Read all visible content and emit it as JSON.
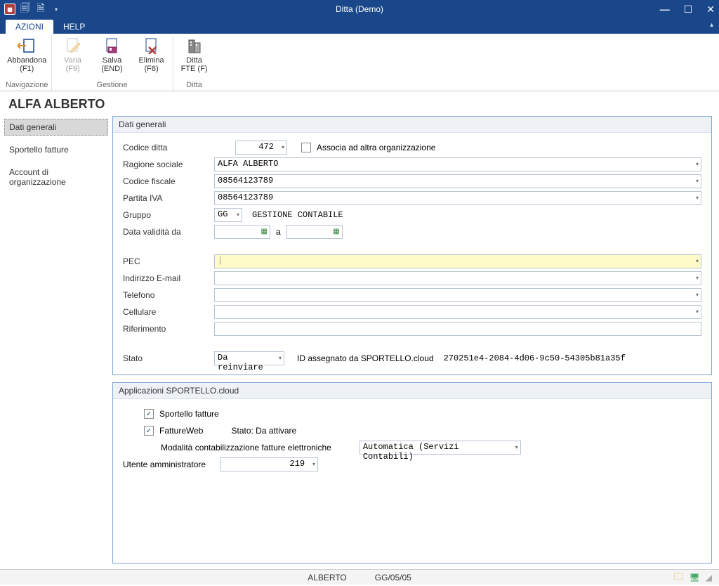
{
  "window": {
    "title": "Ditta  (Demo)"
  },
  "tabs": {
    "azioni": "AZIONI",
    "help": "HELP"
  },
  "ribbon": {
    "groups": {
      "navigazione": {
        "label": "Navigazione",
        "abbandona": {
          "label": "Abbandona",
          "sub": "(F1)"
        }
      },
      "gestione": {
        "label": "Gestione",
        "varia": {
          "label": "Varia",
          "sub": "(F9)"
        },
        "salva": {
          "label": "Salva",
          "sub": "(END)"
        },
        "elimina": {
          "label": "Elimina",
          "sub": "(F8)"
        }
      },
      "ditta": {
        "label": "Ditta",
        "dittafte": {
          "label": "Ditta",
          "sub": "FTE (F)"
        }
      }
    }
  },
  "heading": "ALFA ALBERTO",
  "sidebar": {
    "items": [
      {
        "label": "Dati generali"
      },
      {
        "label": "Sportello fatture"
      },
      {
        "label": "Account di organizzazione"
      }
    ]
  },
  "panel1": {
    "title": "Dati generali",
    "labels": {
      "codice_ditta": "Codice ditta",
      "associa": "Associa ad altra organizzazione",
      "ragione": "Ragione sociale",
      "cf": "Codice fiscale",
      "piva": "Partita IVA",
      "gruppo": "Gruppo",
      "gruppo_desc": "GESTIONE CONTABILE",
      "validita": "Data validità da",
      "a": "a",
      "pec": "PEC",
      "email": "Indirizzo E-mail",
      "tel": "Telefono",
      "cell": "Cellulare",
      "rif": "Riferimento",
      "stato": "Stato",
      "id_label": "ID assegnato da SPORTELLO.cloud"
    },
    "values": {
      "codice_ditta": "472",
      "ragione": "ALFA ALBERTO",
      "cf": "08564123789",
      "piva": "08564123789",
      "gruppo_code": "GG",
      "validita_da": "",
      "validita_a": "",
      "pec": "",
      "email": "",
      "tel": "",
      "cell": "",
      "rif": "",
      "stato": "Da reinviare",
      "id": "270251e4-2084-4d06-9c50-54305b81a35f"
    }
  },
  "panel2": {
    "title": "Applicazioni SPORTELLO.cloud",
    "sportello_fatture": "Sportello fatture",
    "fattureweb": "FattureWeb",
    "fw_stato_label": "Stato: Da attivare",
    "mod_label": "Modalità contabilizzazione fatture elettroniche",
    "mod_value": "Automatica (Servizi Contabili)",
    "utente_label": "Utente amministratore",
    "utente_value": "219"
  },
  "status": {
    "user": "ALBERTO",
    "date": "GG/05/05"
  }
}
